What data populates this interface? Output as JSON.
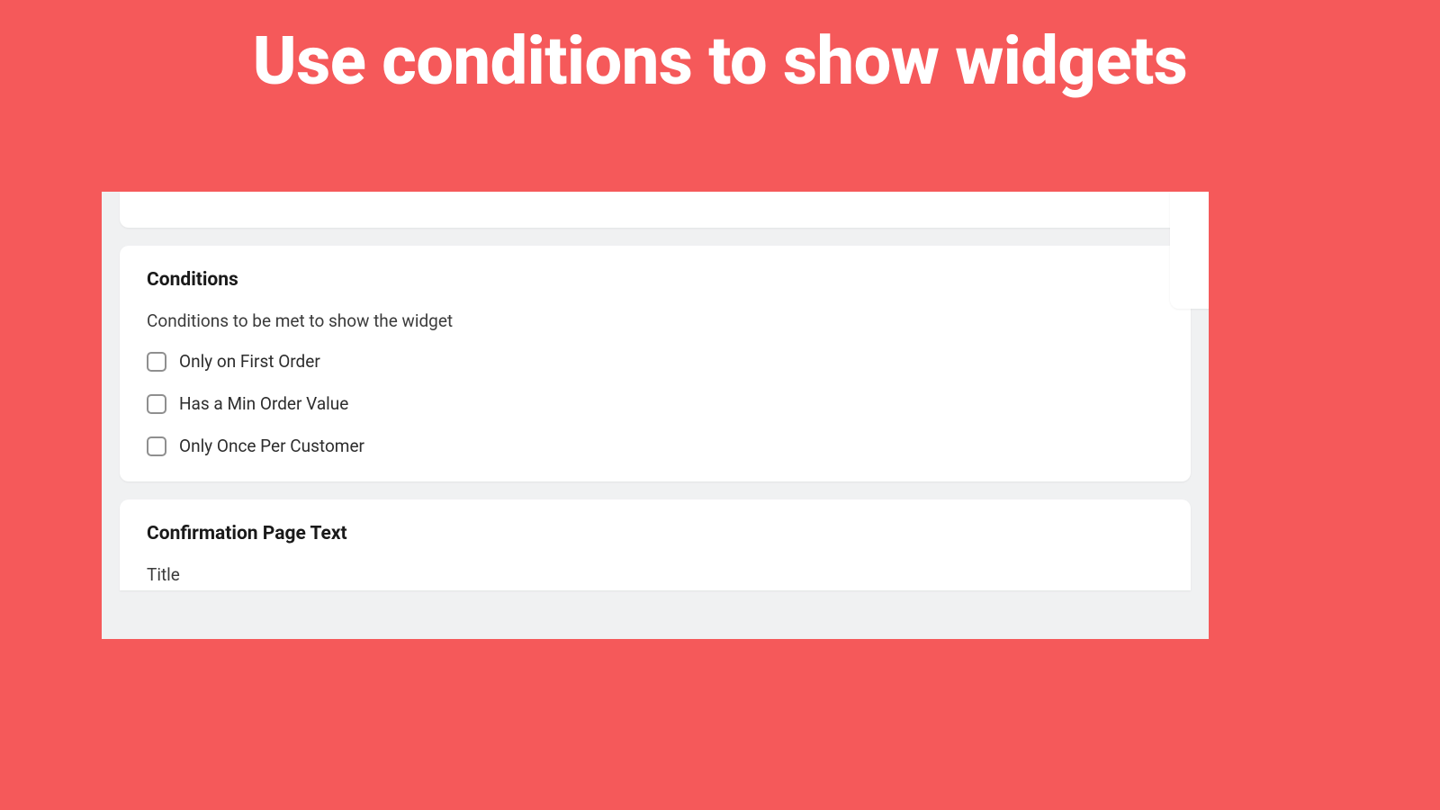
{
  "headline": "Use conditions to show widgets",
  "conditions": {
    "heading": "Conditions",
    "description": "Conditions to be met to show the widget",
    "items": [
      {
        "label": "Only on First Order"
      },
      {
        "label": "Has a Min Order Value"
      },
      {
        "label": "Only Once Per Customer"
      }
    ]
  },
  "confirmation": {
    "heading": "Confirmation Page Text",
    "field_label": "Title"
  }
}
